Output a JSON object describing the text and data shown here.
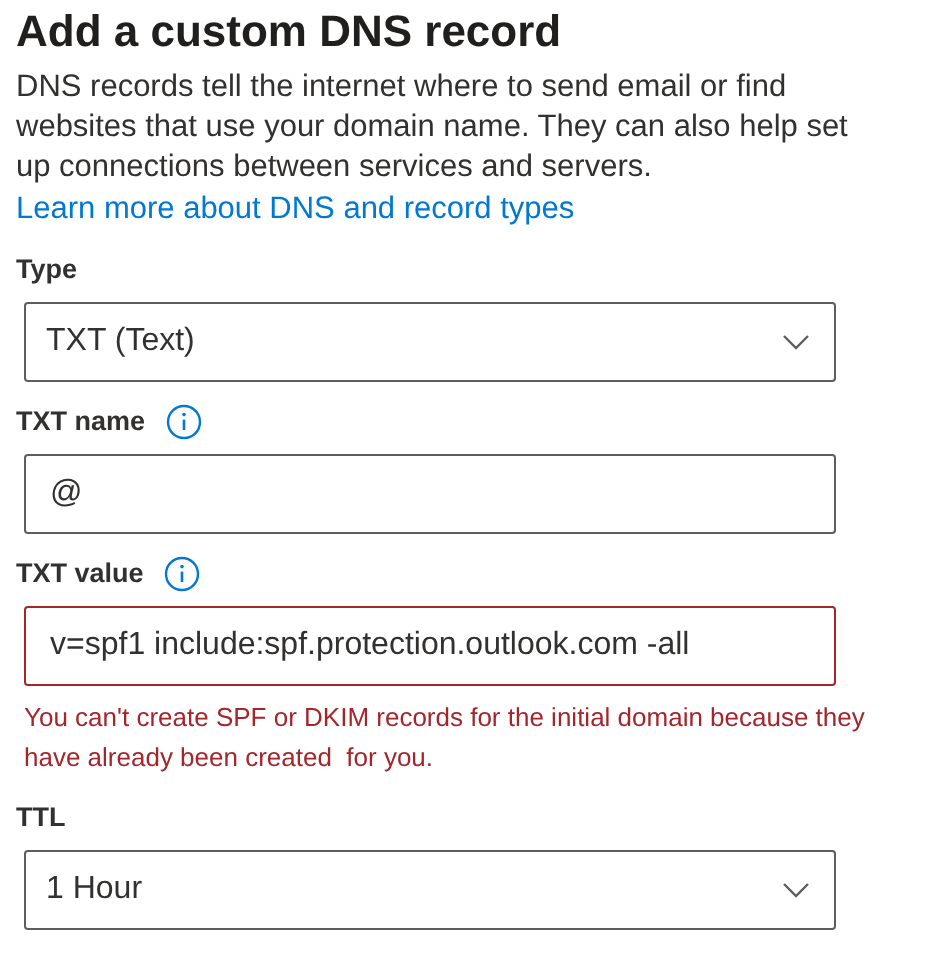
{
  "title": "Add a custom DNS record",
  "description": "DNS records tell the internet where to send email or find websites that use your domain name. They can also help set up connections between services and servers.",
  "learn_more_link": "Learn more about DNS and record types",
  "fields": [
    {
      "kind": "dropdown",
      "label": "Type",
      "info": false,
      "value": "TXT (Text)",
      "invalid": false
    },
    {
      "kind": "text",
      "label": "TXT name",
      "info": true,
      "value": "@",
      "invalid": false
    },
    {
      "kind": "text",
      "label": "TXT value",
      "info": true,
      "value": "v=spf1 include:spf.protection.outlook.com -all",
      "invalid": true,
      "error": "You can't create SPF or DKIM records for the initial domain because they have already been created  for you."
    },
    {
      "kind": "dropdown",
      "label": "TTL",
      "info": false,
      "value": "1 Hour",
      "invalid": false
    }
  ]
}
